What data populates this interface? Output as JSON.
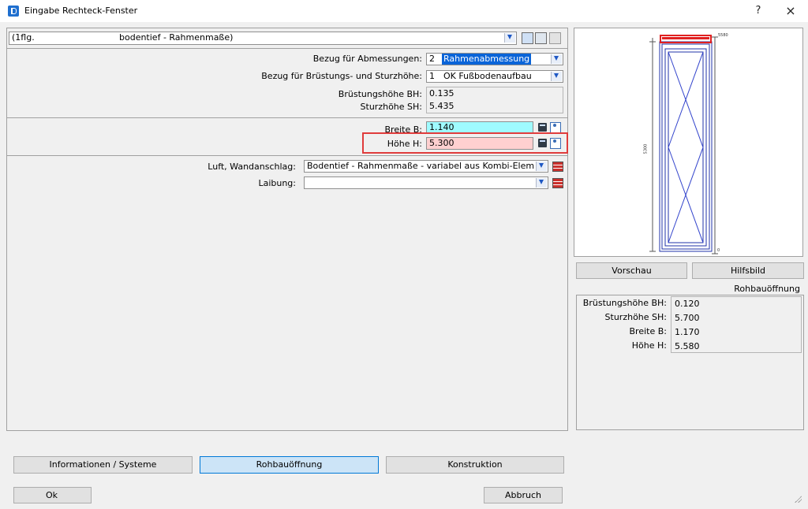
{
  "window": {
    "title": "Eingabe Rechteck-Fenster",
    "help_label": "?",
    "close_label": "×"
  },
  "top_select": {
    "prefix": "(1flg.",
    "value": "bodentief - Rahmenmaße)"
  },
  "section1": {
    "bezug_abm_label": "Bezug für Abmessungen:",
    "bezug_abm_num": "2",
    "bezug_abm_value": "Rahmenabmessung",
    "bezug_bs_label": "Bezug für Brüstungs- und Sturzhöhe:",
    "bezug_bs_num": "1",
    "bezug_bs_value": "OK Fußbodenaufbau",
    "bh_label": "Brüstungshöhe BH:",
    "bh_value": "0.135",
    "sh_label": "Sturzhöhe SH:",
    "sh_value": "5.435"
  },
  "section2": {
    "breite_label": "Breite B:",
    "breite_value": "1.140",
    "hoehe_label": "Höhe H:",
    "hoehe_value": "5.300"
  },
  "section3": {
    "luft_label": "Luft, Wandanschlag:",
    "luft_value": "Bodentief - Rahmenmaße - variabel aus Kombi-Elem",
    "laibung_label": "Laibung:",
    "laibung_value": ""
  },
  "preview": {
    "dim_top": "5580",
    "dim_bottom": "0",
    "dim_side": "5300",
    "btn_vorschau": "Vorschau",
    "btn_hilfsbild": "Hilfsbild",
    "heading": "Rohbauöffnung",
    "bh_label": "Brüstungshöhe BH:",
    "bh_value": "0.120",
    "sh_label": "Sturzhöhe SH:",
    "sh_value": "5.700",
    "b_label": "Breite B:",
    "b_value": "1.170",
    "h_label": "Höhe H:",
    "h_value": "5.580"
  },
  "tabs": {
    "info": "Informationen / Systeme",
    "rohbau": "Rohbauöffnung",
    "konstruktion": "Konstruktion"
  },
  "footer": {
    "ok": "Ok",
    "abbruch": "Abbruch"
  },
  "colors": {
    "breite_bg": "#9ffbff",
    "hoehe_bg": "#ffd0d0",
    "highlight": "#e03c3c",
    "selection": "#0a64d8"
  }
}
